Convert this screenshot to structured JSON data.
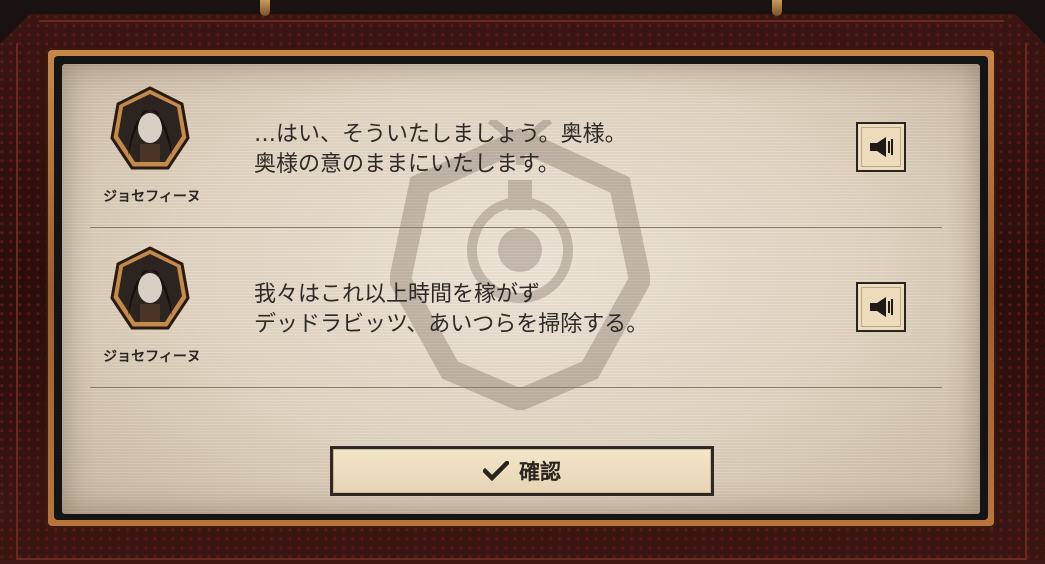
{
  "dialog": {
    "messages": [
      {
        "speaker": "ジョセフィーヌ",
        "line1": "…はい、そういたしましょう。奥様。",
        "line2": "奥様の意のままにいたします。",
        "voice_icon": "speaker-icon"
      },
      {
        "speaker": "ジョセフィーヌ",
        "line1": "我々はこれ以上時間を稼がず",
        "line2": "デッドラビッツ、あいつらを掃除する。",
        "voice_icon": "speaker-icon"
      }
    ],
    "confirm_label": "確認",
    "confirm_icon": "checkmark-icon"
  },
  "colors": {
    "frame_red": "#3a1512",
    "copper": "#b8763c",
    "parchment": "#e2d5c2",
    "text": "#2e2a26"
  }
}
